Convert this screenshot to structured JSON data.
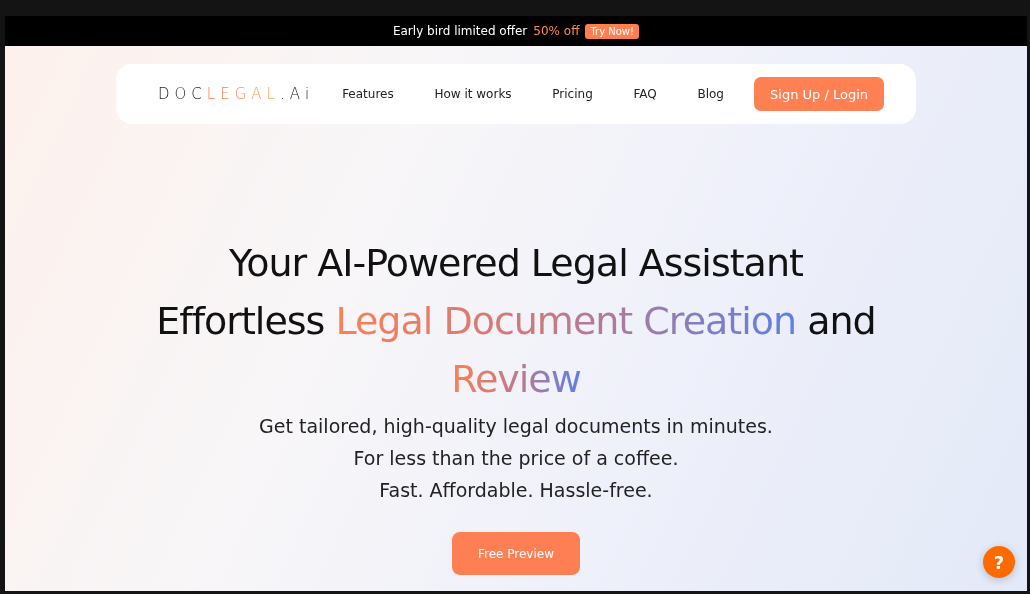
{
  "banner": {
    "text": "Early bird limited offer",
    "highlight": "50% off",
    "button": "Try Now!"
  },
  "nav": {
    "logo": [
      {
        "text": "DOC",
        "kind": "dark"
      },
      {
        "text": "LEGAL",
        "kind": "accent"
      },
      {
        "text": ".Ai",
        "kind": "dark"
      }
    ],
    "links": [
      "Features",
      "How it works",
      "Pricing",
      "FAQ",
      "Blog"
    ],
    "cta": "Sign Up / Login"
  },
  "hero": {
    "lines": [
      [
        {
          "text": "Your AI-Powered Legal Assistant",
          "kind": "plain"
        }
      ],
      [
        {
          "text": "Effortless ",
          "kind": "plain"
        },
        {
          "text": "Legal Document Creation",
          "kind": "gradient"
        },
        {
          "text": " and",
          "kind": "plain"
        }
      ],
      [
        {
          "text": "Review",
          "kind": "gradient"
        }
      ]
    ],
    "subtitle": [
      "Get tailored, high-quality legal documents in minutes.",
      "For less than the price of a coffee.",
      "Fast. Affordable. Hassle-free."
    ],
    "button": "Free Preview"
  },
  "help": "?"
}
